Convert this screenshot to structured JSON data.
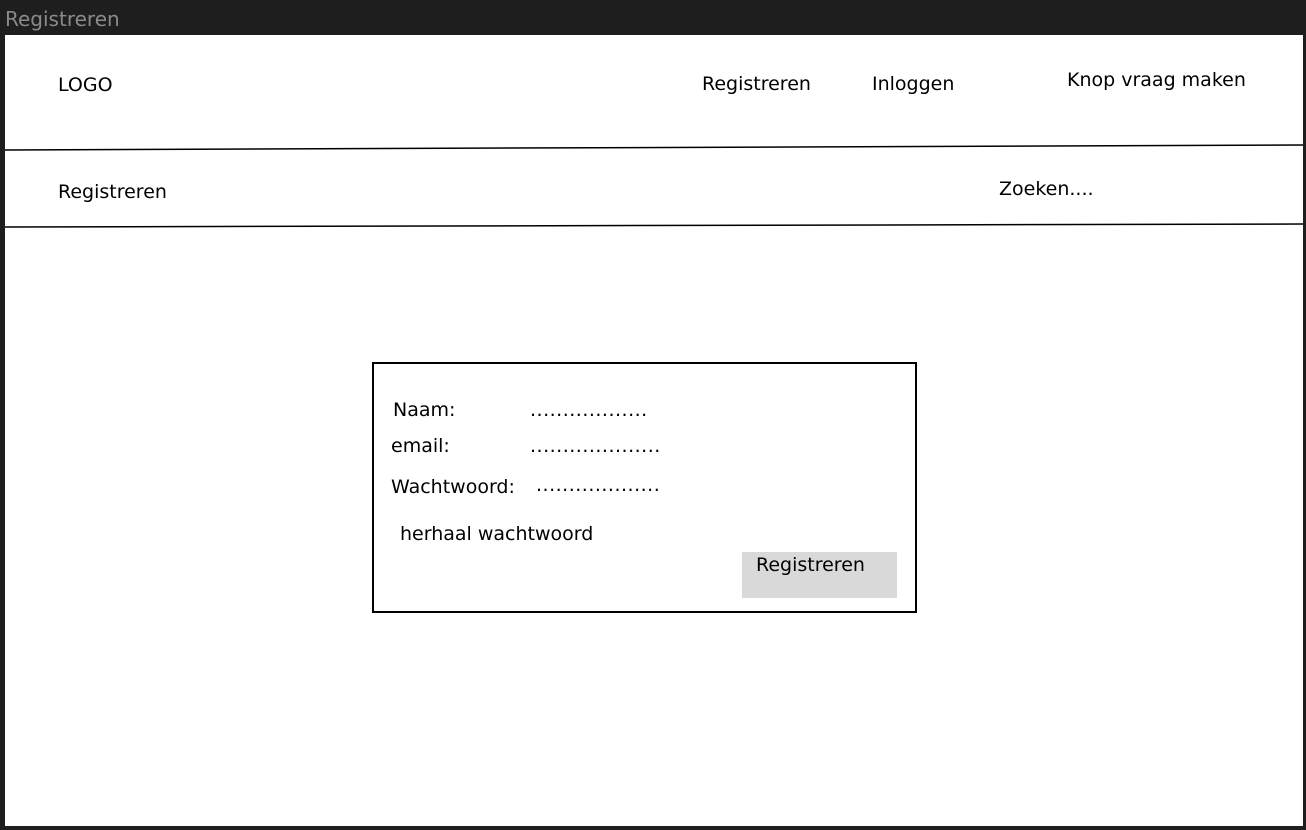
{
  "window": {
    "title": "Registreren"
  },
  "header": {
    "logo": "LOGO",
    "nav": {
      "register": "Registreren",
      "login": "Inloggen",
      "ask_question": "Knop vraag maken"
    }
  },
  "subheader": {
    "page_title": "Registreren",
    "search": "Zoeken...."
  },
  "form": {
    "name_label": "Naam:",
    "name_value": "..................",
    "email_label": "email:",
    "email_value": "....................",
    "password_label": "Wachtwoord:",
    "password_value": "...................",
    "repeat_password_label": "herhaal wachtwoord",
    "submit_label": "Registreren"
  }
}
